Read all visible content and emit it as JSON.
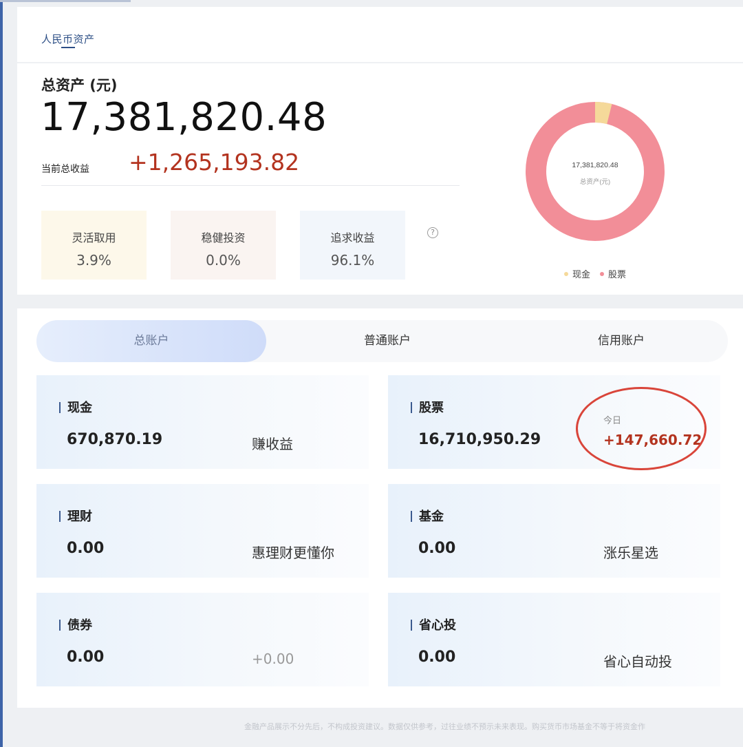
{
  "header": {
    "tab_label": "人民币资产"
  },
  "summary": {
    "total_title": "总资产 (元)",
    "total_value": "17,381,820.48",
    "profit_label": "当前总收益",
    "profit_value": "+1,265,193.82",
    "ratios": [
      {
        "label": "灵活取用",
        "value": "3.9%"
      },
      {
        "label": "稳健投资",
        "value": "0.0%"
      },
      {
        "label": "追求收益",
        "value": "96.1%"
      }
    ],
    "help_icon": "question-circle-icon",
    "donut": {
      "center_value": "17,381,820.48",
      "center_label": "总资产(元)",
      "legend": [
        {
          "name": "现金",
          "color": "#f5d99a",
          "share": 0.039
        },
        {
          "name": "股票",
          "color": "#f28e98",
          "share": 0.961
        }
      ]
    }
  },
  "tabs": [
    {
      "label": "总账户",
      "active": true
    },
    {
      "label": "普通账户",
      "active": false
    },
    {
      "label": "信用账户",
      "active": false
    }
  ],
  "accounts": {
    "cash": {
      "name": "现金",
      "value": "670,870.19",
      "side": "赚收益"
    },
    "stock": {
      "name": "股票",
      "value": "16,710,950.29",
      "today_label": "今日",
      "today_value": "+147,660.72"
    },
    "wealth": {
      "name": "理财",
      "value": "0.00",
      "side": "惠理财更懂你"
    },
    "fund": {
      "name": "基金",
      "value": "0.00",
      "side": "涨乐星选"
    },
    "bond": {
      "name": "债券",
      "value": "0.00",
      "side": "+0.00"
    },
    "easy": {
      "name": "省心投",
      "value": "0.00",
      "side": "省心自动投"
    }
  },
  "footer": {
    "disclaimer": "金融产品展示不分先后，不构成投资建议。数据仅供参考，过往业绩不预示未来表现。购买货币市场基金不等于将资金作"
  },
  "colors": {
    "accent": "#2d4f86",
    "profit": "#b3331f",
    "annotation": "#d9453a"
  }
}
